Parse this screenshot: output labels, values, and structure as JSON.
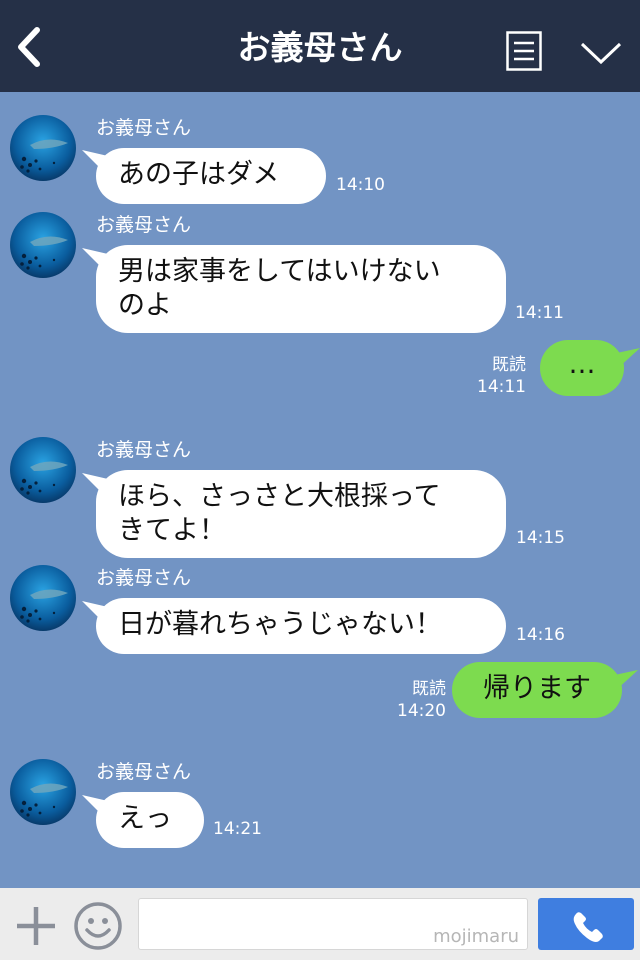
{
  "header": {
    "title": "お義母さん",
    "back_icon": "chevron-left-icon",
    "menu_icon": "menu-icon",
    "collapse_icon": "chevron-down-icon"
  },
  "messages": [
    {
      "sender": "お義母さん",
      "text": "あの子はダメ",
      "time": "14:10"
    },
    {
      "sender": "お義母さん",
      "line1": "男は家事をしてはいけない",
      "line2": "のよ",
      "time": "14:11"
    },
    {
      "read": "既読",
      "text": "…",
      "time": "14:11"
    },
    {
      "sender": "お義母さん",
      "line1": "ほら、さっさと大根採って",
      "line2": "きてよ！",
      "time": "14:15"
    },
    {
      "sender": "お義母さん",
      "text": "日が暮れちゃうじゃない！",
      "time": "14:16"
    },
    {
      "read": "既読",
      "text": "帰ります",
      "time": "14:20"
    },
    {
      "sender": "お義母さん",
      "text": "えっ",
      "time": "14:21"
    }
  ],
  "footer": {
    "input_placeholder": "",
    "watermark": "mojimaru",
    "plus_icon": "plus-icon",
    "emoji_icon": "smiley-icon",
    "call_icon": "phone-icon"
  },
  "colors": {
    "background": "#7294c4",
    "header": "#253047",
    "incoming_bubble": "#ffffff",
    "outgoing_bubble": "#7ddb4f",
    "call_button": "#3f7ee0"
  }
}
